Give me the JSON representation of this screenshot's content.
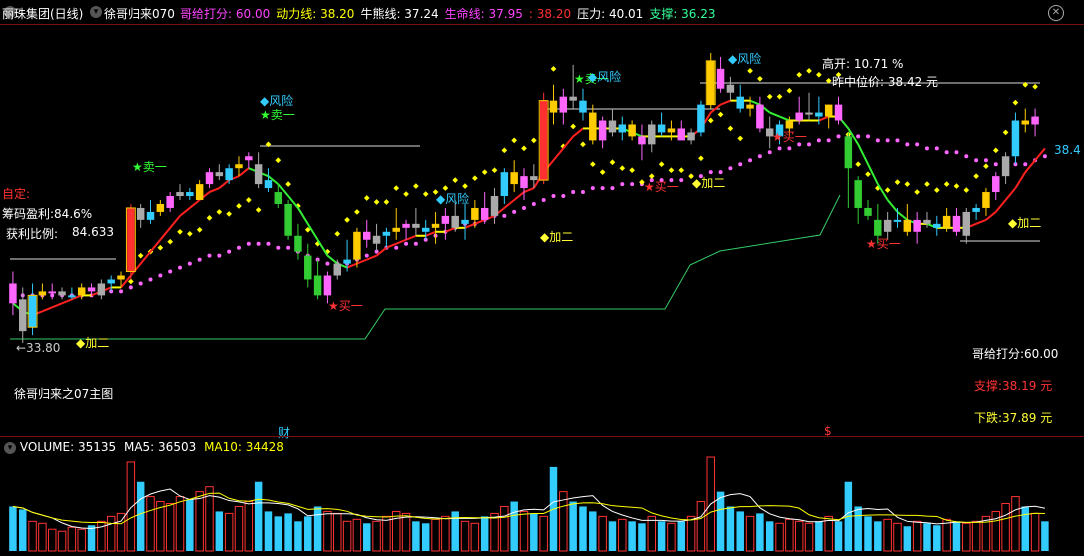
{
  "header": {
    "stock": "丽珠集团(日线)",
    "indicator": "徐哥归来070",
    "items": [
      {
        "label": "哥给打分:",
        "value": "60.00",
        "color": "#ff44ff"
      },
      {
        "label": "动力线:",
        "value": "38.20",
        "color": "#ffff00"
      },
      {
        "label": "牛熊线:",
        "value": "37.24",
        "color": "#ffffff"
      },
      {
        "label": "生命线:",
        "value": "37.95",
        "color": "#ff44ff"
      },
      {
        "label": ":",
        "value": "38.20",
        "color": "#ff3030"
      },
      {
        "label": "压力:",
        "value": "40.01",
        "color": "#ffffff"
      },
      {
        "label": "支撑:",
        "value": "36.23",
        "color": "#33ff99"
      }
    ]
  },
  "left_panel": {
    "zi_ding": "自定:",
    "chip_profit": "筹码盈利:84.6%",
    "profit_ratio_label": "获利比例:",
    "profit_ratio_value": "84.633",
    "low_price": "←33.80",
    "footer_title": "徐哥归来之07主图"
  },
  "top_right": {
    "gao_kai": "高开: 10.71 %",
    "zuo_zhong": "昨中位价: 38.42 元",
    "right_price": "38.4"
  },
  "signals": {
    "sell": "卖一",
    "buy": "买一",
    "risk": "风险",
    "add": "加二",
    "cai": "财",
    "s_mark": "$"
  },
  "bottom_right": {
    "score": "哥给打分:60.00",
    "support": "支撑:38.19 元",
    "decline": "下跌:37.89 元"
  },
  "volume": {
    "label": "VOLUME:",
    "value": "35135",
    "ma5_label": "MA5:",
    "ma5": "36503",
    "ma10_label": "MA10:",
    "ma10": "34428"
  },
  "colors": {
    "up": "#ff3030",
    "down": "#33cc33",
    "yellow": "#ffff00",
    "magenta": "#ff66ff",
    "cyan": "#33ccff",
    "white": "#ffffff",
    "green_line": "#33ee33",
    "red_line": "#ff2020"
  },
  "chart_data": {
    "type": "candlestick",
    "y_range": [
      33.5,
      41.3
    ],
    "candles": [
      {
        "o": 35.3,
        "h": 35.6,
        "l": 34.5,
        "c": 34.8
      },
      {
        "o": 34.9,
        "h": 35.2,
        "l": 33.8,
        "c": 34.1
      },
      {
        "o": 34.2,
        "h": 35.3,
        "l": 34.0,
        "c": 35.0
      },
      {
        "o": 35.0,
        "h": 35.3,
        "l": 34.9,
        "c": 35.1
      },
      {
        "o": 35.1,
        "h": 35.3,
        "l": 34.9,
        "c": 35.1
      },
      {
        "o": 35.0,
        "h": 35.2,
        "l": 34.9,
        "c": 35.1
      },
      {
        "o": 35.0,
        "h": 35.2,
        "l": 34.9,
        "c": 35.0
      },
      {
        "o": 35.0,
        "h": 35.3,
        "l": 34.9,
        "c": 35.2
      },
      {
        "o": 35.2,
        "h": 35.3,
        "l": 35.0,
        "c": 35.1
      },
      {
        "o": 35.0,
        "h": 35.4,
        "l": 34.9,
        "c": 35.3
      },
      {
        "o": 35.3,
        "h": 35.5,
        "l": 35.1,
        "c": 35.4
      },
      {
        "o": 35.4,
        "h": 35.6,
        "l": 35.2,
        "c": 35.5
      },
      {
        "o": 35.6,
        "h": 37.3,
        "l": 35.4,
        "c": 37.2
      },
      {
        "o": 37.2,
        "h": 37.3,
        "l": 36.7,
        "c": 36.9
      },
      {
        "o": 36.9,
        "h": 37.4,
        "l": 36.8,
        "c": 37.1
      },
      {
        "o": 37.1,
        "h": 37.4,
        "l": 37.0,
        "c": 37.3
      },
      {
        "o": 37.2,
        "h": 37.6,
        "l": 37.1,
        "c": 37.5
      },
      {
        "o": 37.5,
        "h": 37.8,
        "l": 37.4,
        "c": 37.6
      },
      {
        "o": 37.6,
        "h": 37.7,
        "l": 37.4,
        "c": 37.5
      },
      {
        "o": 37.4,
        "h": 37.9,
        "l": 37.4,
        "c": 37.8
      },
      {
        "o": 37.8,
        "h": 38.2,
        "l": 37.7,
        "c": 38.1
      },
      {
        "o": 38.1,
        "h": 38.3,
        "l": 37.9,
        "c": 38.0
      },
      {
        "o": 37.9,
        "h": 38.3,
        "l": 37.8,
        "c": 38.2
      },
      {
        "o": 38.2,
        "h": 38.5,
        "l": 38.0,
        "c": 38.3
      },
      {
        "o": 38.4,
        "h": 38.6,
        "l": 38.2,
        "c": 38.5
      },
      {
        "o": 38.3,
        "h": 38.6,
        "l": 37.7,
        "c": 37.8
      },
      {
        "o": 37.9,
        "h": 38.2,
        "l": 37.6,
        "c": 37.7
      },
      {
        "o": 37.6,
        "h": 37.8,
        "l": 37.2,
        "c": 37.3
      },
      {
        "o": 37.3,
        "h": 37.4,
        "l": 36.4,
        "c": 36.5
      },
      {
        "o": 36.5,
        "h": 36.8,
        "l": 35.9,
        "c": 36.1
      },
      {
        "o": 36.0,
        "h": 36.3,
        "l": 35.2,
        "c": 35.4
      },
      {
        "o": 35.5,
        "h": 35.9,
        "l": 34.9,
        "c": 35.0
      },
      {
        "o": 35.0,
        "h": 35.6,
        "l": 34.8,
        "c": 35.5
      },
      {
        "o": 35.5,
        "h": 35.9,
        "l": 35.4,
        "c": 35.8
      },
      {
        "o": 35.8,
        "h": 36.4,
        "l": 35.6,
        "c": 35.9
      },
      {
        "o": 35.9,
        "h": 36.7,
        "l": 35.7,
        "c": 36.6
      },
      {
        "o": 36.6,
        "h": 36.9,
        "l": 36.2,
        "c": 36.4
      },
      {
        "o": 36.3,
        "h": 36.8,
        "l": 36.1,
        "c": 36.5
      },
      {
        "o": 36.5,
        "h": 36.7,
        "l": 36.2,
        "c": 36.6
      },
      {
        "o": 36.6,
        "h": 37.2,
        "l": 36.4,
        "c": 36.7
      },
      {
        "o": 36.7,
        "h": 36.9,
        "l": 36.4,
        "c": 36.8
      },
      {
        "o": 36.8,
        "h": 37.2,
        "l": 36.5,
        "c": 36.7
      },
      {
        "o": 36.7,
        "h": 36.9,
        "l": 36.4,
        "c": 36.6
      },
      {
        "o": 36.7,
        "h": 37.1,
        "l": 36.3,
        "c": 36.8
      },
      {
        "o": 36.8,
        "h": 37.2,
        "l": 36.4,
        "c": 37.0
      },
      {
        "o": 37.0,
        "h": 37.4,
        "l": 36.6,
        "c": 36.7
      },
      {
        "o": 36.8,
        "h": 37.3,
        "l": 36.4,
        "c": 36.9
      },
      {
        "o": 36.9,
        "h": 37.4,
        "l": 36.7,
        "c": 37.2
      },
      {
        "o": 37.2,
        "h": 37.6,
        "l": 36.8,
        "c": 36.9
      },
      {
        "o": 37.0,
        "h": 37.7,
        "l": 36.8,
        "c": 37.5
      },
      {
        "o": 37.5,
        "h": 38.2,
        "l": 37.3,
        "c": 38.1
      },
      {
        "o": 38.1,
        "h": 38.4,
        "l": 37.6,
        "c": 37.8
      },
      {
        "o": 37.7,
        "h": 38.2,
        "l": 37.4,
        "c": 38.0
      },
      {
        "o": 38.0,
        "h": 38.3,
        "l": 37.7,
        "c": 37.9
      },
      {
        "o": 37.9,
        "h": 40.1,
        "l": 37.8,
        "c": 39.9
      },
      {
        "o": 39.9,
        "h": 40.3,
        "l": 39.3,
        "c": 39.6
      },
      {
        "o": 39.6,
        "h": 40.2,
        "l": 39.3,
        "c": 40.0
      },
      {
        "o": 40.0,
        "h": 40.8,
        "l": 39.7,
        "c": 39.9
      },
      {
        "o": 39.9,
        "h": 40.2,
        "l": 39.4,
        "c": 39.6
      },
      {
        "o": 39.6,
        "h": 39.8,
        "l": 38.8,
        "c": 38.9
      },
      {
        "o": 38.9,
        "h": 39.5,
        "l": 38.7,
        "c": 39.4
      },
      {
        "o": 39.4,
        "h": 39.7,
        "l": 39.0,
        "c": 39.1
      },
      {
        "o": 39.1,
        "h": 39.5,
        "l": 38.9,
        "c": 39.3
      },
      {
        "o": 39.3,
        "h": 39.4,
        "l": 38.9,
        "c": 39.0
      },
      {
        "o": 39.0,
        "h": 39.3,
        "l": 38.4,
        "c": 38.8
      },
      {
        "o": 38.8,
        "h": 39.4,
        "l": 38.6,
        "c": 39.3
      },
      {
        "o": 39.3,
        "h": 39.6,
        "l": 39.0,
        "c": 39.1
      },
      {
        "o": 39.1,
        "h": 39.4,
        "l": 38.9,
        "c": 39.2
      },
      {
        "o": 39.2,
        "h": 39.4,
        "l": 38.9,
        "c": 38.9
      },
      {
        "o": 38.9,
        "h": 39.2,
        "l": 38.8,
        "c": 39.1
      },
      {
        "o": 39.1,
        "h": 39.9,
        "l": 39.0,
        "c": 39.8
      },
      {
        "o": 39.8,
        "h": 41.1,
        "l": 39.7,
        "c": 40.9
      },
      {
        "o": 40.7,
        "h": 41.0,
        "l": 40.1,
        "c": 40.2
      },
      {
        "o": 40.3,
        "h": 40.5,
        "l": 39.9,
        "c": 40.1
      },
      {
        "o": 40.0,
        "h": 40.3,
        "l": 39.6,
        "c": 39.7
      },
      {
        "o": 39.7,
        "h": 40.0,
        "l": 39.5,
        "c": 39.8
      },
      {
        "o": 39.8,
        "h": 40.0,
        "l": 39.1,
        "c": 39.2
      },
      {
        "o": 39.2,
        "h": 39.5,
        "l": 38.7,
        "c": 39.0
      },
      {
        "o": 39.0,
        "h": 39.4,
        "l": 38.8,
        "c": 39.3
      },
      {
        "o": 39.2,
        "h": 39.5,
        "l": 39.0,
        "c": 39.4
      },
      {
        "o": 39.4,
        "h": 40.0,
        "l": 39.3,
        "c": 39.6
      },
      {
        "o": 39.6,
        "h": 40.1,
        "l": 39.4,
        "c": 39.6
      },
      {
        "o": 39.6,
        "h": 40.0,
        "l": 39.3,
        "c": 39.5
      },
      {
        "o": 39.5,
        "h": 39.8,
        "l": 39.2,
        "c": 39.8
      },
      {
        "o": 39.8,
        "h": 40.0,
        "l": 39.3,
        "c": 39.4
      },
      {
        "o": 39.0,
        "h": 39.1,
        "l": 37.2,
        "c": 38.2
      },
      {
        "o": 37.9,
        "h": 38.0,
        "l": 36.8,
        "c": 37.2
      },
      {
        "o": 37.2,
        "h": 37.4,
        "l": 36.9,
        "c": 37.0
      },
      {
        "o": 36.9,
        "h": 37.3,
        "l": 36.3,
        "c": 36.5
      },
      {
        "o": 36.6,
        "h": 37.1,
        "l": 36.4,
        "c": 36.9
      },
      {
        "o": 36.9,
        "h": 37.2,
        "l": 36.7,
        "c": 36.9
      },
      {
        "o": 36.9,
        "h": 37.3,
        "l": 36.5,
        "c": 36.6
      },
      {
        "o": 36.6,
        "h": 37.1,
        "l": 36.3,
        "c": 36.9
      },
      {
        "o": 36.9,
        "h": 37.1,
        "l": 36.7,
        "c": 36.8
      },
      {
        "o": 36.8,
        "h": 37.0,
        "l": 36.5,
        "c": 36.7
      },
      {
        "o": 36.7,
        "h": 37.2,
        "l": 36.6,
        "c": 37.0
      },
      {
        "o": 37.0,
        "h": 37.2,
        "l": 36.5,
        "c": 36.6
      },
      {
        "o": 36.5,
        "h": 37.2,
        "l": 36.3,
        "c": 37.1
      },
      {
        "o": 37.1,
        "h": 37.3,
        "l": 36.9,
        "c": 37.2
      },
      {
        "o": 37.2,
        "h": 37.7,
        "l": 37.0,
        "c": 37.6
      },
      {
        "o": 37.6,
        "h": 38.1,
        "l": 37.4,
        "c": 38.0
      },
      {
        "o": 38.0,
        "h": 38.6,
        "l": 37.8,
        "c": 38.5
      },
      {
        "o": 38.5,
        "h": 39.6,
        "l": 38.3,
        "c": 39.4
      },
      {
        "o": 39.4,
        "h": 39.7,
        "l": 39.1,
        "c": 39.3
      },
      {
        "o": 39.3,
        "h": 39.7,
        "l": 39.0,
        "c": 39.5
      }
    ],
    "ma_dynamic": [
      34.8,
      34.6,
      34.5,
      34.6,
      34.7,
      34.8,
      34.9,
      35.0,
      35.0,
      35.1,
      35.2,
      35.2,
      35.5,
      35.8,
      36.1,
      36.4,
      36.7,
      37.0,
      37.2,
      37.4,
      37.6,
      37.7,
      37.9,
      38.0,
      38.2,
      38.1,
      38.0,
      37.8,
      37.5,
      37.2,
      36.8,
      36.4,
      36.0,
      35.8,
      35.7,
      35.8,
      35.9,
      36.0,
      36.2,
      36.3,
      36.4,
      36.5,
      36.5,
      36.6,
      36.6,
      36.7,
      36.7,
      36.8,
      36.9,
      37.0,
      37.2,
      37.4,
      37.6,
      37.7,
      38.1,
      38.4,
      38.7,
      39.0,
      39.2,
      39.2,
      39.2,
      39.2,
      39.2,
      39.1,
      39.0,
      39.0,
      39.0,
      39.0,
      39.0,
      39.0,
      39.2,
      39.6,
      39.8,
      39.9,
      39.9,
      39.9,
      39.8,
      39.6,
      39.5,
      39.4,
      39.4,
      39.4,
      39.4,
      39.5,
      39.5,
      39.2,
      38.8,
      38.3,
      37.8,
      37.4,
      37.1,
      36.9,
      36.8,
      36.8,
      36.7,
      36.7,
      36.7,
      36.7,
      36.8,
      36.9,
      37.1,
      37.4,
      37.7,
      38.1,
      38.4,
      38.7
    ],
    "life_line": [
      35.0,
      35.0,
      35.0,
      35.0,
      35.0,
      35.0,
      35.0,
      35.0,
      35.0,
      35.1,
      35.1,
      35.1,
      35.2,
      35.3,
      35.4,
      35.5,
      35.6,
      35.7,
      35.8,
      35.9,
      36.0,
      36.0,
      36.1,
      36.2,
      36.3,
      36.3,
      36.3,
      36.2,
      36.2,
      36.1,
      36.0,
      35.9,
      35.8,
      35.8,
      35.8,
      35.9,
      36.0,
      36.1,
      36.2,
      36.2,
      36.3,
      36.3,
      36.4,
      36.5,
      36.6,
      36.7,
      36.8,
      36.8,
      36.9,
      37.0,
      37.0,
      37.1,
      37.2,
      37.3,
      37.4,
      37.5,
      37.5,
      37.6,
      37.6,
      37.7,
      37.7,
      37.7,
      37.8,
      37.8,
      37.8,
      37.9,
      37.9,
      37.9,
      37.9,
      38.0,
      38.0,
      38.1,
      38.1,
      38.2,
      38.3,
      38.4,
      38.5,
      38.6,
      38.7,
      38.7,
      38.8,
      38.8,
      38.9,
      38.9,
      39.0,
      39.0,
      39.0,
      39.0,
      38.9,
      38.9,
      38.9,
      38.8,
      38.8,
      38.7,
      38.7,
      38.6,
      38.6,
      38.5,
      38.4,
      38.4,
      38.3,
      38.3,
      38.3,
      38.3,
      38.4,
      38.5
    ],
    "support_line": [
      34.5,
      34.5,
      34.5,
      34.5,
      34.5,
      34.5,
      34.5,
      34.5,
      34.5,
      34.5,
      34.5,
      34.5,
      34.5,
      34.5,
      34.5,
      34.5,
      34.5,
      34.5,
      34.5,
      34.5,
      34.5,
      34.5,
      34.5,
      34.5,
      34.5,
      34.5,
      34.5,
      34.5,
      34.5,
      34.5,
      34.5,
      34.5,
      34.5,
      34.5,
      34.5,
      34.5,
      34.5,
      34.5,
      34.5,
      34.5,
      34.5,
      34.5,
      34.5,
      34.5,
      34.5,
      34.5,
      34.5,
      34.5,
      34.5,
      34.5,
      34.5,
      34.5,
      34.5,
      34.5,
      34.5,
      34.5,
      34.5,
      34.5,
      34.5,
      34.5,
      34.5,
      34.5,
      34.5,
      34.5,
      34.5,
      34.5,
      34.5,
      34.5,
      34.5,
      34.5,
      34.5,
      34.5,
      34.5,
      34.5,
      34.5,
      34.5,
      34.5,
      34.5,
      34.5,
      34.5,
      34.5,
      34.5,
      34.5,
      34.5,
      34.5,
      34.5,
      34.5,
      34.5,
      34.5,
      34.5,
      34.5,
      34.5,
      34.5,
      34.5,
      34.5,
      34.5,
      34.5,
      34.5,
      34.5,
      34.5,
      34.5,
      34.5,
      34.5,
      34.5,
      34.5,
      34.5
    ],
    "volume": {
      "values": [
        45,
        42,
        30,
        28,
        22,
        20,
        24,
        22,
        26,
        30,
        35,
        38,
        90,
        70,
        55,
        50,
        48,
        55,
        52,
        60,
        65,
        40,
        38,
        45,
        50,
        70,
        40,
        35,
        38,
        30,
        35,
        45,
        40,
        38,
        30,
        32,
        28,
        30,
        35,
        40,
        38,
        30,
        28,
        32,
        35,
        40,
        30,
        28,
        35,
        38,
        45,
        50,
        40,
        38,
        35,
        85,
        60,
        50,
        45,
        40,
        35,
        30,
        32,
        30,
        28,
        35,
        30,
        28,
        30,
        35,
        50,
        95,
        60,
        45,
        40,
        35,
        38,
        30,
        28,
        32,
        30,
        28,
        30,
        35,
        30,
        70,
        45,
        35,
        30,
        32,
        28,
        25,
        30,
        28,
        26,
        32,
        30,
        28,
        30,
        35,
        40,
        48,
        55,
        45,
        38,
        30
      ],
      "ma5": [
        35135,
        36503
      ],
      "ma10": [
        34428
      ]
    }
  }
}
